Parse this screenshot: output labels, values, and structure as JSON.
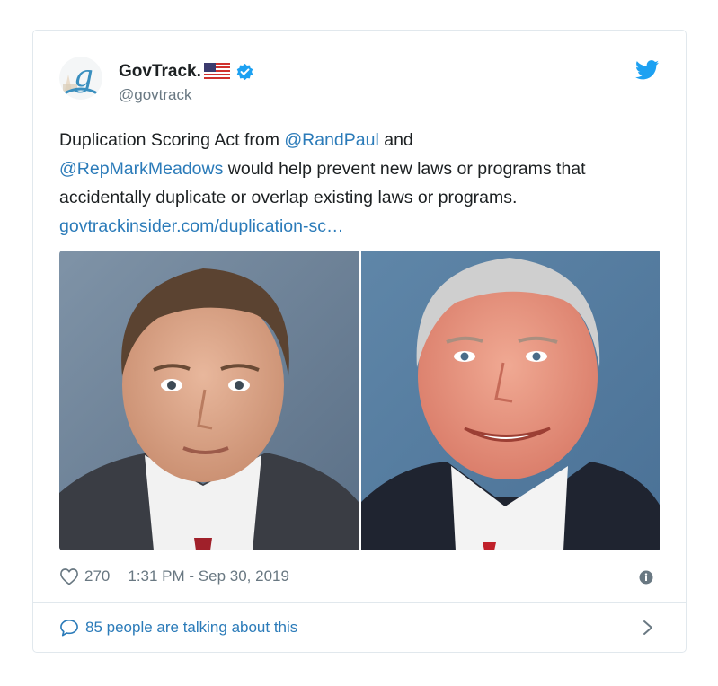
{
  "author": {
    "name": "GovTrack.",
    "handle": "@govtrack",
    "avatar_letter": "g"
  },
  "tweet": {
    "text_intro": "Duplication Scoring Act from ",
    "mention_1": "@RandPaul",
    "text_and": " and",
    "mention_2": "@RepMarkMeadows",
    "text_body": " would help prevent new laws or programs that accidentally duplicate or overlap existing laws or programs.",
    "link": "govtrackinsider.com/duplication-sc…"
  },
  "footer": {
    "likes": "270",
    "timestamp": "1:31 PM - Sep 30, 2019",
    "talking": "85 people are talking about this"
  },
  "icons": {
    "bird": "twitter-bird-icon",
    "verified": "verified-badge-icon",
    "flag": "us-flag-icon",
    "heart": "heart-icon",
    "info": "info-icon",
    "bubble": "speech-bubble-icon",
    "chevron": "chevron-right-icon"
  },
  "colors": {
    "link": "#2b7bb9",
    "twitter_blue": "#1da1f2",
    "muted": "#697882",
    "text": "#1c2022",
    "border": "#e1e8ed"
  }
}
